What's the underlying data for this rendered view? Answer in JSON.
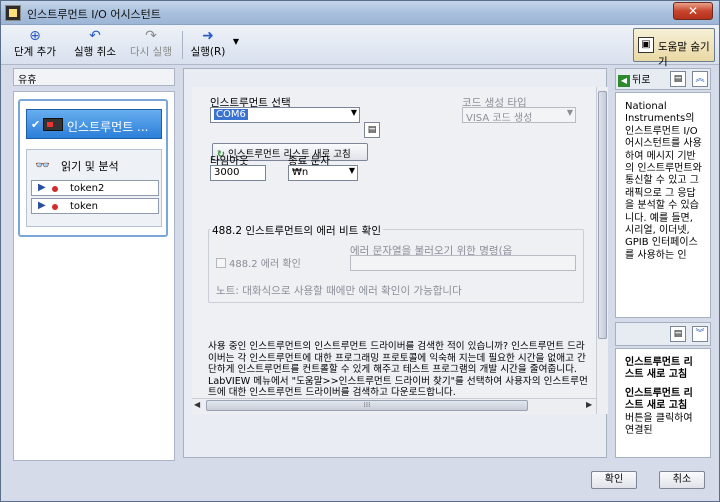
{
  "window": {
    "title": "인스트루먼트 I/O 어시스턴트",
    "close_label": "✕"
  },
  "toolbar": {
    "add_step": "단계 추가",
    "undo": "실행 취소",
    "redo": "다시 실행",
    "run": "실행(R)",
    "hide_help": "도움말 숨기기"
  },
  "sidebar": {
    "header": "유휴",
    "steps": [
      {
        "label": "인스트루먼트 ..."
      },
      {
        "label": "읽기 및 분석",
        "tokens": [
          "token2",
          "token"
        ]
      }
    ]
  },
  "form": {
    "instrument_select_label": "인스트루먼트 선택",
    "instrument_value": "COM6",
    "refresh_label": "인스트루먼트 리스트 새로 고침",
    "codegen_label": "코드 생성 타입",
    "codegen_value": "VISA 코드 생성",
    "timeout_label": "타임아웃",
    "timeout_value": "3000",
    "termchar_label": "종료 문자",
    "termchar_value": "₩n",
    "error_group_title": "488.2 인스트루먼트의 에러 비트 확인",
    "error_check_label": "488.2 에러 확인",
    "error_cmd_label": "에러 문자열을 불러오기 위한 명령(옵",
    "error_note": "노트: 대화식으로 사용할 때에만 에러 확인이 가능합니다",
    "description": "사용 중인 인스트루먼트의 인스트루먼트 드라이버를 검색한 적이 있습니까? 인스트루먼트 드라이버는 각 인스트루먼트에 대한 프로그래밍 프로토콜에 익숙해 지는데 필요한 시간을 없애고 간단하게 인스트루먼트를 컨트롤할 수 있게 해주고 테스트 프로그램의 개발 시간을 줄여줍니다. LabVIEW 메뉴에서 \"도움말>>인스트루먼트 드라이버 찾기\"를 선택하여 사용자의 인스트루먼트에 대한 인스트루먼트 드라이버를 검색하고 다운로드합니다."
  },
  "help": {
    "back_label": "뒤로",
    "text1": "National Instruments의 인스트루먼트 I/O 어시스턴트를 사용하여 메시지 기반의 인스트루먼트와 통신할 수 있고 그래픽으로 그 응답을 분석할 수 있습니다. 예를 들면, 시리얼, 이더넷, GPIB 인터페이스를 사용하는 인",
    "text2_title1": "인스트루먼트 리스트 새로 고침",
    "text2_title2": "인스트루먼트 리스트 새로 고침",
    "text2_body": "버튼을 클릭하여 연결된"
  },
  "footer": {
    "ok": "확인",
    "cancel": "취소"
  }
}
